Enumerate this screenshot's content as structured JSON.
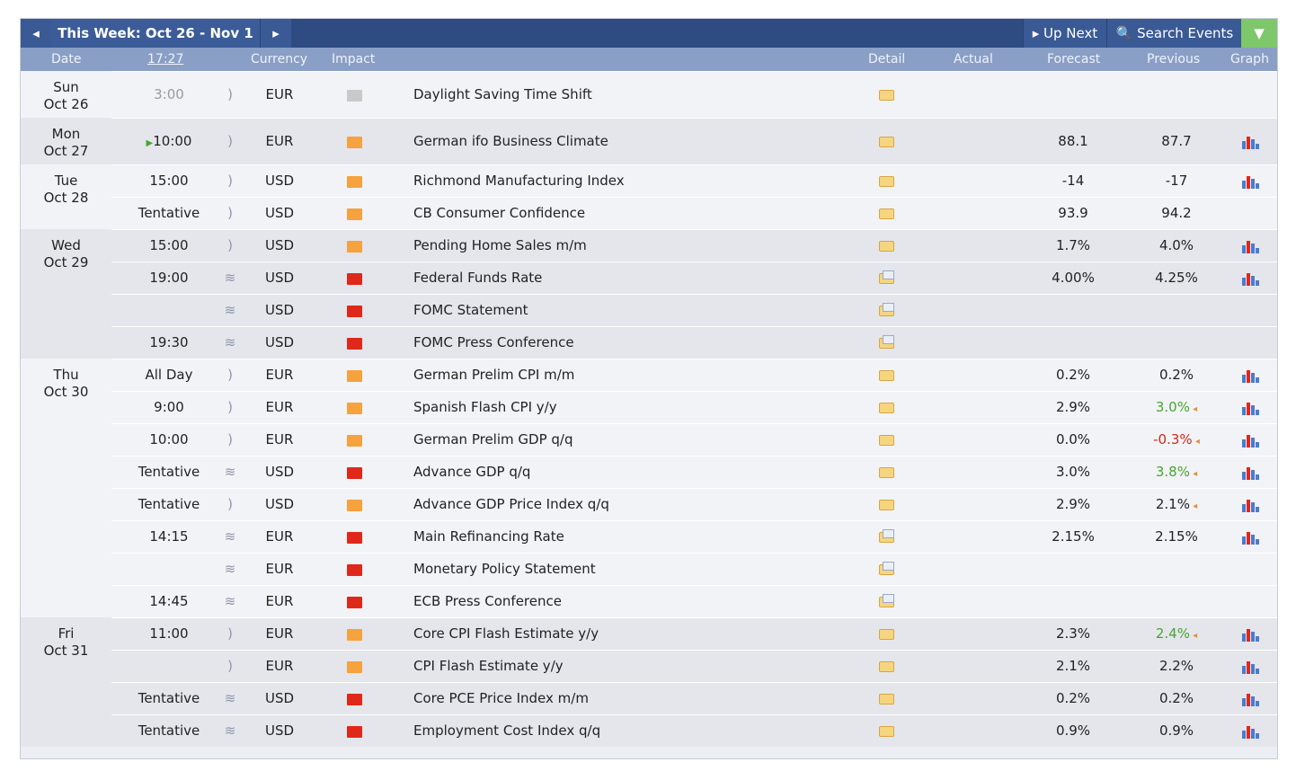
{
  "toolbar": {
    "prev_icon": "◂",
    "week_label": "This Week: Oct 26 - Nov 1",
    "next_icon": "▸",
    "up_next_label": "▸ Up Next",
    "search_label": "🔍 Search Events",
    "filter_icon": "▼"
  },
  "columns": {
    "date": "Date",
    "time": "17:27",
    "currency": "Currency",
    "impact": "Impact",
    "detail": "Detail",
    "actual": "Actual",
    "forecast": "Forecast",
    "previous": "Previous",
    "graph": "Graph"
  },
  "days": [
    {
      "day": "Sun",
      "date": "Oct 26",
      "rows": [
        {
          "time": "3:00",
          "vol": ")",
          "currency": "EUR",
          "impact": "low",
          "event": "Daylight Saving Time Shift",
          "detail": "folder",
          "actual": "",
          "forecast": "",
          "previous": "",
          "graph": false
        }
      ]
    },
    {
      "day": "Mon",
      "date": "Oct 27",
      "rows": [
        {
          "time": "10:00",
          "upnext": true,
          "vol": ")",
          "currency": "EUR",
          "impact": "med",
          "event": "German ifo Business Climate",
          "detail": "folder",
          "actual": "",
          "forecast": "88.1",
          "previous": "87.7",
          "graph": true
        }
      ]
    },
    {
      "day": "Tue",
      "date": "Oct 28",
      "rows": [
        {
          "time": "15:00",
          "vol": ")",
          "currency": "USD",
          "impact": "med",
          "event": "Richmond Manufacturing Index",
          "detail": "folder",
          "actual": "",
          "forecast": "-14",
          "previous": "-17",
          "graph": true
        },
        {
          "time": "Tentative",
          "vol": ")",
          "currency": "USD",
          "impact": "med",
          "event": "CB Consumer Confidence",
          "detail": "folder",
          "actual": "",
          "forecast": "93.9",
          "previous": "94.2",
          "graph": false
        }
      ]
    },
    {
      "day": "Wed",
      "date": "Oct 29",
      "rows": [
        {
          "time": "15:00",
          "vol": ")",
          "currency": "USD",
          "impact": "med",
          "event": "Pending Home Sales m/m",
          "detail": "folder",
          "actual": "",
          "forecast": "1.7%",
          "previous": "4.0%",
          "graph": true
        },
        {
          "time": "19:00",
          "vol": "wifi",
          "currency": "USD",
          "impact": "high",
          "event": "Federal Funds Rate",
          "detail": "ppt",
          "actual": "",
          "forecast": "4.00%",
          "previous": "4.25%",
          "graph": true
        },
        {
          "time": "",
          "vol": "wifi",
          "currency": "USD",
          "impact": "high",
          "event": "FOMC Statement",
          "detail": "ppt",
          "actual": "",
          "forecast": "",
          "previous": "",
          "graph": false
        },
        {
          "time": "19:30",
          "vol": "wifi",
          "currency": "USD",
          "impact": "high",
          "event": "FOMC Press Conference",
          "detail": "ppt",
          "actual": "",
          "forecast": "",
          "previous": "",
          "graph": false
        }
      ]
    },
    {
      "day": "Thu",
      "date": "Oct 30",
      "rows": [
        {
          "time": "All Day",
          "vol": ")",
          "currency": "EUR",
          "impact": "med",
          "event": "German Prelim CPI m/m",
          "detail": "folder",
          "actual": "",
          "forecast": "0.2%",
          "previous": "0.2%",
          "graph": true
        },
        {
          "time": "9:00",
          "vol": ")",
          "currency": "EUR",
          "impact": "med",
          "event": "Spanish Flash CPI y/y",
          "detail": "folder",
          "actual": "",
          "forecast": "2.9%",
          "previous": "3.0%",
          "prev_color": "green",
          "revised": true,
          "graph": true
        },
        {
          "time": "10:00",
          "vol": ")",
          "currency": "EUR",
          "impact": "med",
          "event": "German Prelim GDP q/q",
          "detail": "folder",
          "actual": "",
          "forecast": "0.0%",
          "previous": "-0.3%",
          "prev_color": "red",
          "revised": true,
          "graph": true
        },
        {
          "time": "Tentative",
          "vol": "wifi",
          "currency": "USD",
          "impact": "high",
          "event": "Advance GDP q/q",
          "detail": "folder",
          "actual": "",
          "forecast": "3.0%",
          "previous": "3.8%",
          "prev_color": "green",
          "revised": true,
          "graph": true
        },
        {
          "time": "Tentative",
          "vol": ")",
          "currency": "USD",
          "impact": "med",
          "event": "Advance GDP Price Index q/q",
          "detail": "folder",
          "actual": "",
          "forecast": "2.9%",
          "previous": "2.1%",
          "revised": true,
          "graph": true
        },
        {
          "time": "14:15",
          "vol": "wifi",
          "currency": "EUR",
          "impact": "high",
          "event": "Main Refinancing Rate",
          "detail": "ppt",
          "actual": "",
          "forecast": "2.15%",
          "previous": "2.15%",
          "graph": true
        },
        {
          "time": "",
          "vol": "wifi",
          "currency": "EUR",
          "impact": "high",
          "event": "Monetary Policy Statement",
          "detail": "ppt",
          "actual": "",
          "forecast": "",
          "previous": "",
          "graph": false
        },
        {
          "time": "14:45",
          "vol": "wifi",
          "currency": "EUR",
          "impact": "high",
          "event": "ECB Press Conference",
          "detail": "ppt",
          "actual": "",
          "forecast": "",
          "previous": "",
          "graph": false
        }
      ]
    },
    {
      "day": "Fri",
      "date": "Oct 31",
      "rows": [
        {
          "time": "11:00",
          "vol": ")",
          "currency": "EUR",
          "impact": "med",
          "event": "Core CPI Flash Estimate y/y",
          "detail": "folder",
          "actual": "",
          "forecast": "2.3%",
          "previous": "2.4%",
          "prev_color": "green",
          "revised": true,
          "graph": true
        },
        {
          "time": "",
          "vol": ")",
          "currency": "EUR",
          "impact": "med",
          "event": "CPI Flash Estimate y/y",
          "detail": "folder",
          "actual": "",
          "forecast": "2.1%",
          "previous": "2.2%",
          "graph": true
        },
        {
          "time": "Tentative",
          "vol": "wifi",
          "currency": "USD",
          "impact": "high",
          "event": "Core PCE Price Index m/m",
          "detail": "folder",
          "actual": "",
          "forecast": "0.2%",
          "previous": "0.2%",
          "graph": true
        },
        {
          "time": "Tentative",
          "vol": "wifi",
          "currency": "USD",
          "impact": "high",
          "event": "Employment Cost Index q/q",
          "detail": "folder",
          "actual": "",
          "forecast": "0.9%",
          "previous": "0.9%",
          "graph": true
        }
      ]
    }
  ],
  "colors": {
    "header_bg": "#2e4b82",
    "column_header_bg": "#8a9fc6",
    "impact_low": "#c9c9c9",
    "impact_medium": "#f5a23f",
    "impact_high": "#e0281a",
    "better_value": "#47a52f",
    "worse_value": "#d12a1a"
  }
}
